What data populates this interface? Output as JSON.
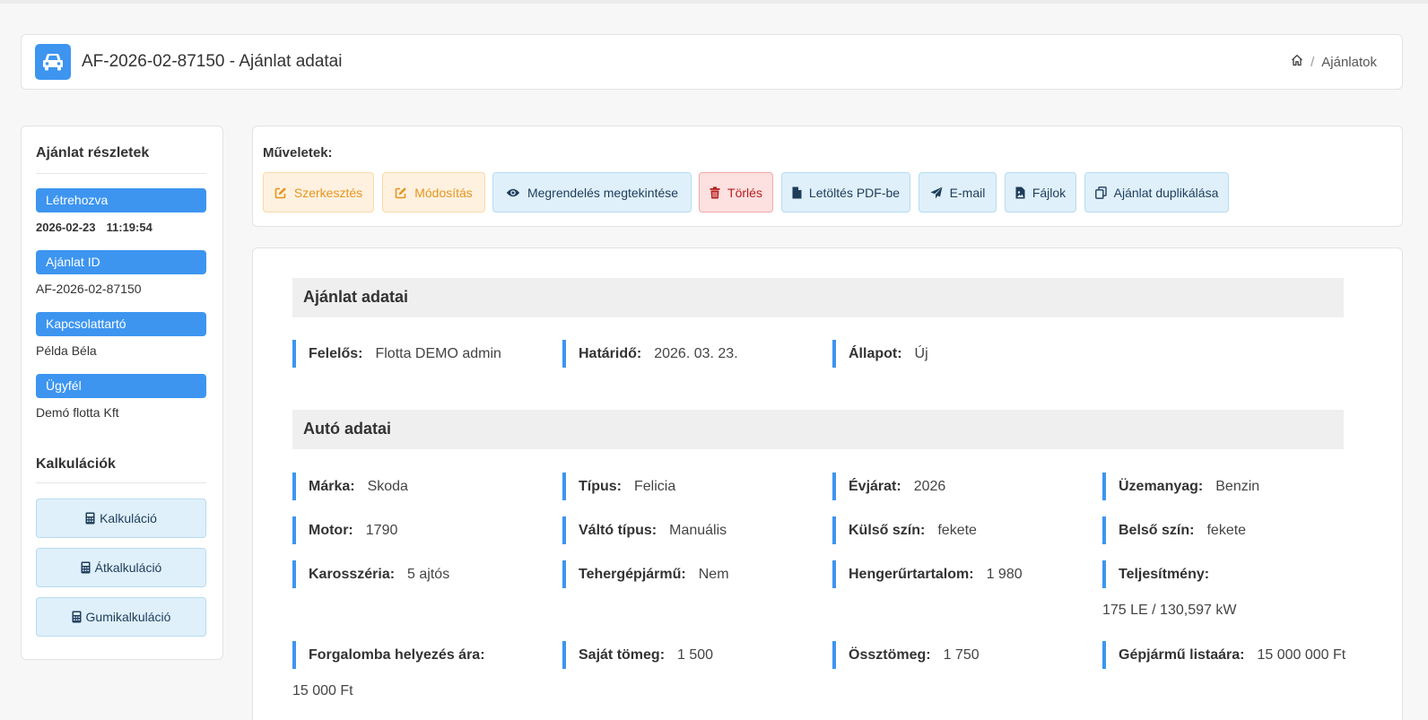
{
  "header": {
    "title": "AF-2026-02-87150 - Ajánlat adatai",
    "breadcrumb": {
      "current": "Ajánlatok"
    }
  },
  "sidebar": {
    "heading": "Ajánlat részletek",
    "created": {
      "label": "Létrehozva",
      "date": "2026-02-23",
      "time": "11:19:54"
    },
    "offer_id": {
      "label": "Ajánlat ID",
      "value": "AF-2026-02-87150"
    },
    "contact": {
      "label": "Kapcsolattartó",
      "value": "Példa Béla"
    },
    "client": {
      "label": "Ügyfél",
      "value": "Demó flotta Kft"
    },
    "calc_heading": "Kalkulációk",
    "calc_buttons": [
      "Kalkuláció",
      "Átkalkuláció",
      "Gumikalkuláció"
    ]
  },
  "actions": {
    "label": "Műveletek:",
    "buttons": [
      "Szerkesztés",
      "Módosítás",
      "Megrendelés megtekintése",
      "Törlés",
      "Letöltés PDF-be",
      "E-mail",
      "Fájlok",
      "Ajánlat duplikálása"
    ]
  },
  "offer": {
    "heading": "Ajánlat adatai",
    "fields": [
      {
        "label": "Felelős:",
        "value": "Flotta DEMO admin"
      },
      {
        "label": "Határidő:",
        "value": "2026. 03. 23."
      },
      {
        "label": "Állapot:",
        "value": "Új"
      }
    ]
  },
  "car": {
    "heading": "Autó adatai",
    "fields": [
      {
        "label": "Márka:",
        "value": "Skoda"
      },
      {
        "label": "Típus:",
        "value": "Felicia"
      },
      {
        "label": "Évjárat:",
        "value": "2026"
      },
      {
        "label": "Üzemanyag:",
        "value": "Benzin"
      },
      {
        "label": "Motor:",
        "value": "1790"
      },
      {
        "label": "Váltó típus:",
        "value": "Manuális"
      },
      {
        "label": "Külső szín:",
        "value": "fekete"
      },
      {
        "label": "Belső szín:",
        "value": "fekete"
      },
      {
        "label": "Karosszéria:",
        "value": "5 ajtós"
      },
      {
        "label": "Tehergépjármű:",
        "value": "Nem"
      },
      {
        "label": "Hengerűrtartalom:",
        "value": "1 980"
      },
      {
        "label": "Teljesítmény:",
        "value": "175 LE / 130,597 kW"
      },
      {
        "label": "Forgalomba helyezés ára:",
        "value": "15 000 Ft"
      },
      {
        "label": "Saját tömeg:",
        "value": "1 500"
      },
      {
        "label": "Össztömeg:",
        "value": "1 750"
      },
      {
        "label": "Gépjármű listaára:",
        "value": "15 000 000 Ft"
      }
    ]
  }
}
